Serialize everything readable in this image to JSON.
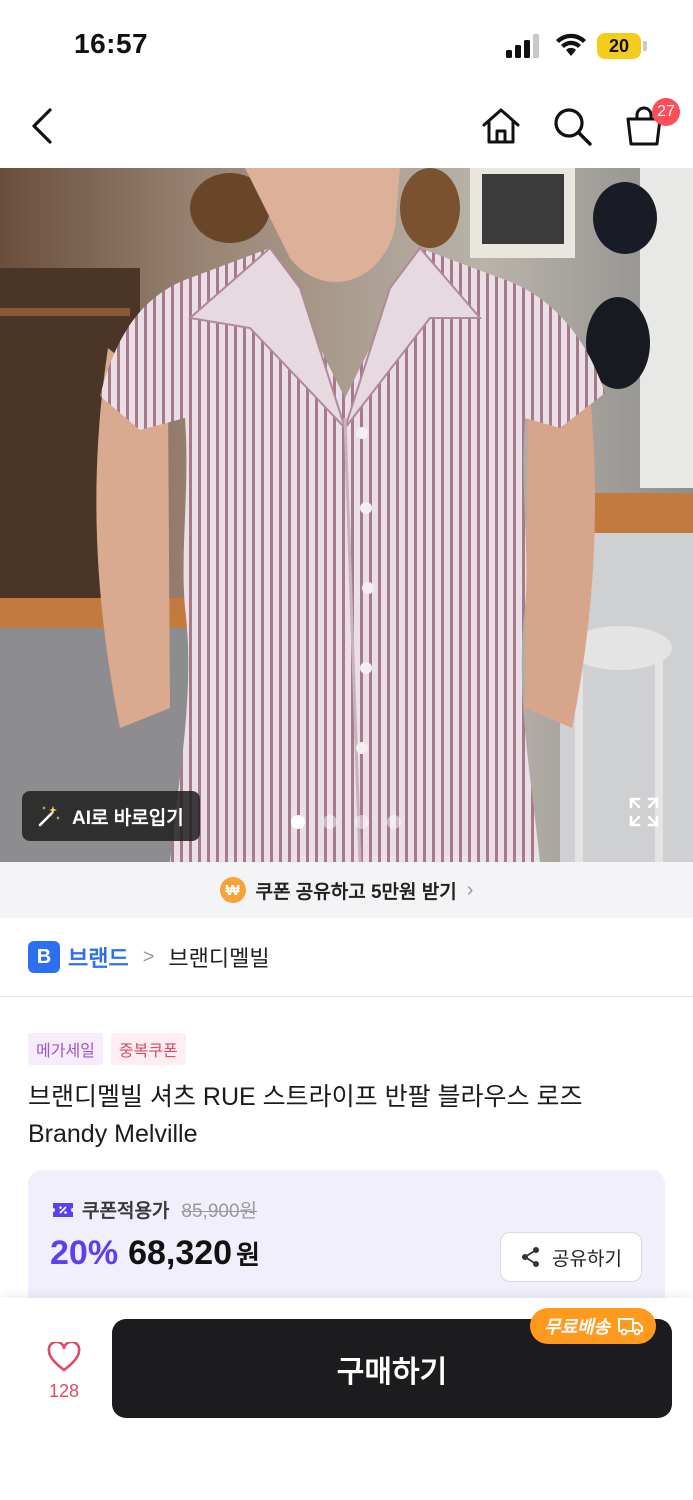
{
  "status_bar": {
    "time": "16:57",
    "battery": "20"
  },
  "nav": {
    "cart_count": "27"
  },
  "hero": {
    "ai_fit_label": "AI로 바로입기",
    "image_count": 4,
    "active_index": 0
  },
  "coupon_banner": {
    "coin": "₩",
    "text": "쿠폰 공유하고 5만원 받기"
  },
  "brand": {
    "badge": "B",
    "label": "브랜드",
    "separator": ">",
    "name": "브랜디멜빌"
  },
  "tags": [
    {
      "label": "메가세일"
    },
    {
      "label": "중복쿠폰"
    }
  ],
  "product": {
    "title_line1": "브랜디멜빌 셔츠 RUE 스트라이프 반팔 블라우스 로즈",
    "title_line2": "Brandy Melville"
  },
  "price": {
    "coupon_label": "쿠폰적용가",
    "original": "85,900원",
    "discount": "20%",
    "final": "68,320",
    "currency": "원",
    "share_label": "공유하기"
  },
  "bottom": {
    "like_count": "128",
    "buy_label": "구매하기",
    "free_shipping": "무료배송"
  },
  "colors": {
    "accent": "#5b3ff2",
    "brand_blue": "#2e6ff2",
    "like_red": "#e04a64",
    "shipping_orange": "#ff9a1f"
  }
}
